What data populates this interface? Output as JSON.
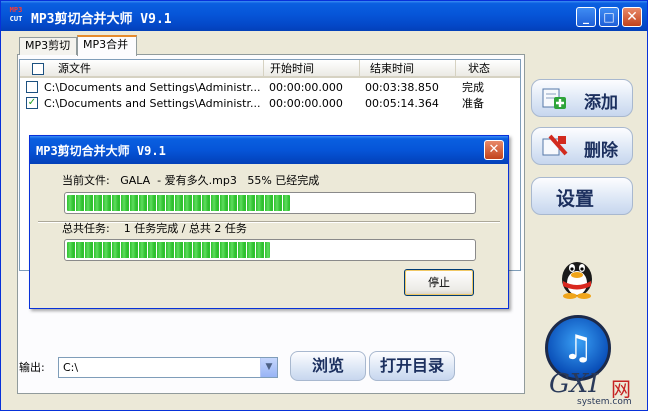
{
  "window": {
    "title": "MP3剪切合并大师 V9.1",
    "logo_text": [
      "MP3",
      "CUT"
    ]
  },
  "titlebar_buttons": {
    "minimize": "_",
    "maximize": "□",
    "close": "✕"
  },
  "tabs": [
    {
      "label": "MP3剪切"
    },
    {
      "label": "MP3合并"
    }
  ],
  "list": {
    "headers": [
      "源文件",
      "开始时间",
      "结束时间",
      "状态"
    ],
    "rows": [
      {
        "checked": false,
        "file": "C:\\Documents and Settings\\Administr...",
        "start": "00:00:00.000",
        "end": "00:03:38.850",
        "status": "完成"
      },
      {
        "checked": true,
        "file": "C:\\Documents and Settings\\Administr...",
        "start": "00:00:00.000",
        "end": "00:05:14.364",
        "status": "准备"
      }
    ]
  },
  "side_buttons": {
    "add": "添加",
    "delete": "删除",
    "settings": "设置"
  },
  "output": {
    "label": "输出:",
    "value": "C:\\",
    "browse": "浏览",
    "open_dir": "打开目录"
  },
  "dialog": {
    "title": "MP3剪切合并大师 V9.1",
    "current_label": "当前文件:",
    "current_file": "GALA  - 爱有多久.mp3",
    "current_progress_text": "55% 已经完成",
    "current_progress": 0.55,
    "total_label": "总共任务:",
    "total_text": "1 任务完成 / 总共 2 任务",
    "total_progress": 0.5,
    "stop_label": "停止"
  },
  "watermark": {
    "logo": "GXI",
    "net": "网",
    "url": "system.com"
  },
  "colors": {
    "titlebar": "#0655d8",
    "progress": "#2fc12f",
    "panel_bg": "#ece9d8"
  }
}
